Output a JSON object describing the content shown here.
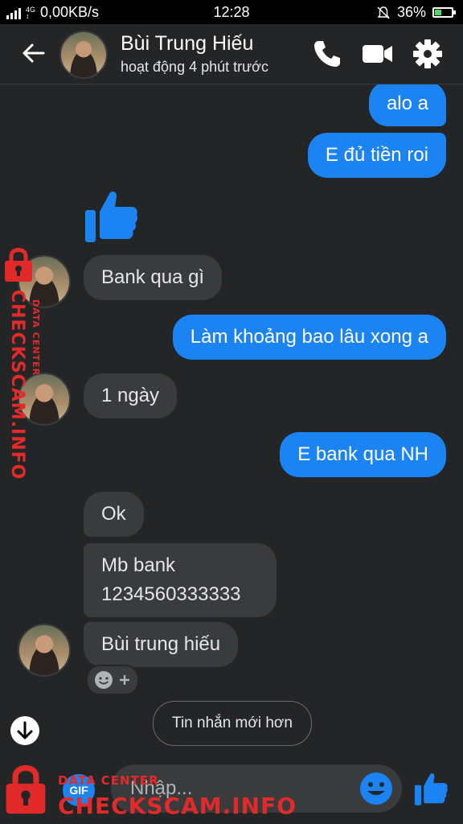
{
  "status_bar": {
    "network_type": "4G",
    "data_rate": "0,00KB/s",
    "time": "12:28",
    "battery_percent": "36%",
    "battery_level": 0.36
  },
  "header": {
    "contact_name": "Bùi Trung Hiếu",
    "presence": "hoạt động 4 phút trước"
  },
  "messages": [
    {
      "from": "me",
      "text": "alo a"
    },
    {
      "from": "me",
      "text": "E đủ tiền roi"
    },
    {
      "from": "me",
      "type": "like-sticker"
    },
    {
      "from": "them",
      "text": "Bank qua gì"
    },
    {
      "from": "me",
      "text": "Làm khoảng bao lâu xong a"
    },
    {
      "from": "them",
      "text": "1 ngày"
    },
    {
      "from": "me",
      "text": "E bank qua NH"
    },
    {
      "from": "them",
      "text": "Ok"
    },
    {
      "from": "them",
      "text_line1": "Mb bank",
      "text_line2": "1234560333333"
    },
    {
      "from": "them",
      "text": "Bùi trung hiếu"
    }
  ],
  "newer_messages_label": "Tin nhắn mới hơn",
  "composer": {
    "gif_label": "GIF",
    "placeholder": "Nhập..."
  },
  "watermark": {
    "brand": "CHECKSCAM.INFO",
    "subtitle": "DATA CENTER"
  },
  "colors": {
    "background": "#242526",
    "outgoing_bubble": "#1b84f2",
    "incoming_bubble": "#3a3b3c",
    "watermark": "#e32a2a"
  }
}
